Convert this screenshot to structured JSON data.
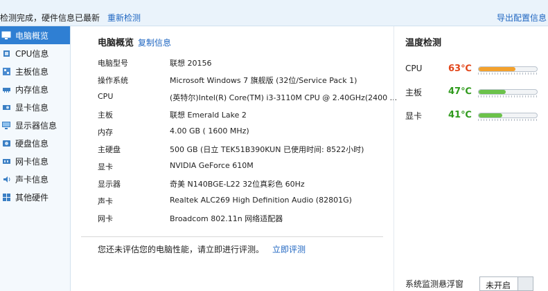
{
  "topbar": {
    "status": "检测完成，硬件信息已最新",
    "rescan_label": "重新检测",
    "export_label": "导出配置信息"
  },
  "sidebar": {
    "items": [
      {
        "label": "电脑概览",
        "icon": "computer-overview-icon",
        "active": true
      },
      {
        "label": "CPU信息",
        "icon": "cpu-icon"
      },
      {
        "label": "主板信息",
        "icon": "motherboard-icon"
      },
      {
        "label": "内存信息",
        "icon": "memory-icon"
      },
      {
        "label": "显卡信息",
        "icon": "graphics-card-icon"
      },
      {
        "label": "显示器信息",
        "icon": "monitor-icon"
      },
      {
        "label": "硬盘信息",
        "icon": "hard-disk-icon"
      },
      {
        "label": "网卡信息",
        "icon": "network-card-icon"
      },
      {
        "label": "声卡信息",
        "icon": "sound-card-icon"
      },
      {
        "label": "其他硬件",
        "icon": "other-hardware-icon"
      }
    ]
  },
  "overview": {
    "title": "电脑概览",
    "copy_label": "复制信息",
    "rows": [
      {
        "label": "电脑型号",
        "value": "联想 20156"
      },
      {
        "label": "操作系统",
        "value": "Microsoft Windows 7 旗舰版 (32位/Service Pack 1)"
      },
      {
        "label": "CPU",
        "value": "(英特尔)Intel(R) Core(TM) i3-3110M CPU @ 2.40GHz(2400 ..."
      },
      {
        "label": "主板",
        "value": "联想 Emerald Lake 2"
      },
      {
        "label": "内存",
        "value": "4.00 GB (   1600 MHz)"
      },
      {
        "label": "主硬盘",
        "value": "500 GB (日立 TEK51B390KUN 已使用时间: 8522小时)"
      },
      {
        "label": "显卡",
        "value": "NVIDIA GeForce 610M"
      },
      {
        "label": "显示器",
        "value": "奇美 N140BGE-L22 32位真彩色 60Hz"
      },
      {
        "label": "声卡",
        "value": "Realtek ALC269 High Definition Audio (82801G)"
      },
      {
        "label": "网卡",
        "value": "Broadcom 802.11n 网络适配器"
      }
    ],
    "assess_text": "您还未评估您的电脑性能，请立即进行评测。",
    "assess_link": "立即评测"
  },
  "temperature": {
    "title": "温度检测",
    "items": [
      {
        "label": "CPU",
        "value": "63℃",
        "color": "#e2461a",
        "level": 0.63,
        "bar_color": "#f3a12d"
      },
      {
        "label": "主板",
        "value": "47℃",
        "color": "#2f9a1c",
        "level": 0.47,
        "bar_color": "#6bc24a"
      },
      {
        "label": "显卡",
        "value": "41℃",
        "color": "#2f9a1c",
        "level": 0.41,
        "bar_color": "#6bc24a"
      }
    ]
  },
  "float_monitor": {
    "label": "系统监测悬浮窗",
    "toggle_label": "未开启"
  }
}
